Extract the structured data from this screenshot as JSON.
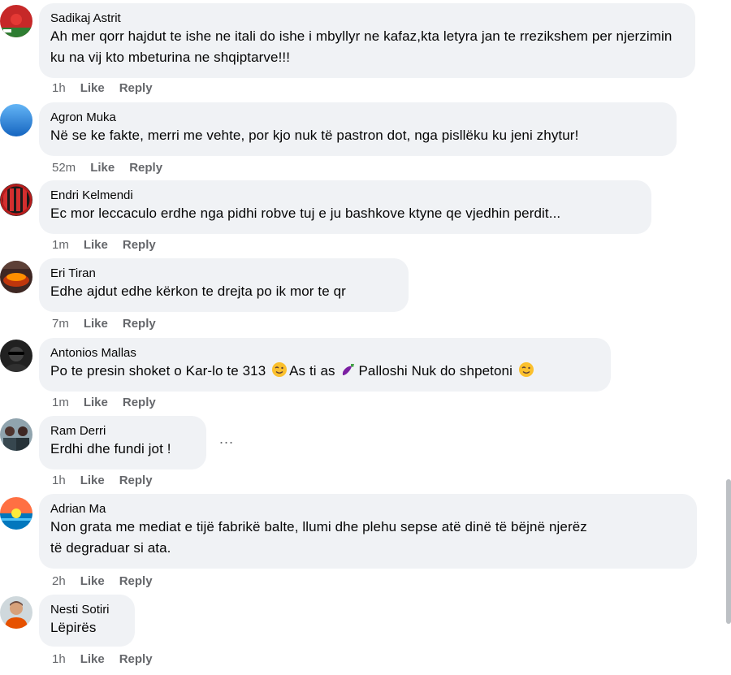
{
  "comments": [
    {
      "author": "Sadikaj Astrit",
      "text": "Ah mer qorr hajdut te ishe ne itali do ishe i mbyllyr ne kafaz,kta letyra jan te rrezikshem per njerzimin ku na vij kto mbeturina ne shqiptarve!!!",
      "time": "1h",
      "like": "Like",
      "reply": "Reply"
    },
    {
      "author": "Agron Muka",
      "text": "Në se ke fakte, merri me vehte, por kjo nuk të pastron dot, nga pisllëku ku jeni zhytur!",
      "time": "52m",
      "like": "Like",
      "reply": "Reply"
    },
    {
      "author": "Endri Kelmendi",
      "text": "Ec mor leccaculo erdhe nga pidhi robve tuj e ju bashkove ktyne qe vjedhin perdit...",
      "time": "1m",
      "like": "Like",
      "reply": "Reply"
    },
    {
      "author": "Eri Tiran",
      "text": "Edhe ajdut edhe kërkon te drejta po ik mor te qr",
      "time": "7m",
      "like": "Like",
      "reply": "Reply"
    },
    {
      "author": "Antonios Mallas",
      "text_part1": "Po te presin shoket o Kar-lo te 313",
      "text_part2": "As ti as",
      "text_part3": "Palloshi Nuk do shpetoni",
      "emoji1": "wink-face-icon",
      "emoji2": "eggplant-icon",
      "emoji3": "wink-face-icon",
      "time": "1m",
      "like": "Like",
      "reply": "Reply"
    },
    {
      "author": "Ram Derri",
      "text": "Erdhi dhe fundi jot !",
      "more": "...",
      "time": "1h",
      "like": "Like",
      "reply": "Reply"
    },
    {
      "author": "Adrian Ma",
      "text_line1": "Non grata me mediat e tijë fabrikë balte, llumi dhe plehu sepse atë dinë të bëjnë njerëz",
      "text_line2": "të degraduar si ata.",
      "time": "2h",
      "like": "Like",
      "reply": "Reply"
    },
    {
      "author": "Nesti Sotiri",
      "text": "Lëpirës",
      "time": "1h",
      "like": "Like",
      "reply": "Reply"
    }
  ],
  "colors": {
    "bubble": "#f0f2f5",
    "meta": "#65676b",
    "text": "#050505"
  }
}
